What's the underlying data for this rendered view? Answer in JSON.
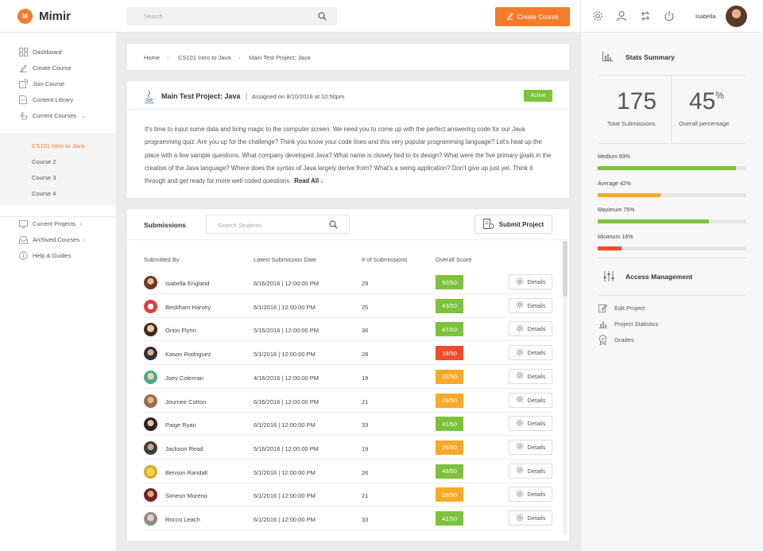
{
  "app": {
    "name": "Mimir",
    "logo_letter": "M"
  },
  "topbar": {
    "search_placeholder": "Search",
    "create_course": "Create Course",
    "username": "Isabella",
    "icons": [
      "gear-icon",
      "user-icon",
      "swap-icon",
      "power-icon"
    ]
  },
  "sidebar": {
    "items": [
      {
        "label": "Dashboard",
        "icon": "grid-icon"
      },
      {
        "label": "Create Course",
        "icon": "pencil-icon"
      },
      {
        "label": "Join Course",
        "icon": "join-icon"
      },
      {
        "label": "Content Library",
        "icon": "document-icon"
      },
      {
        "label": "Current Courses",
        "icon": "hand-icon"
      }
    ],
    "courses": [
      {
        "label": "CS101 Intro to Java",
        "active": true
      },
      {
        "label": "Course 2",
        "active": false
      },
      {
        "label": "Course 3",
        "active": false
      },
      {
        "label": "Course 4",
        "active": false
      }
    ],
    "bottom_items": [
      {
        "label": "Current Projects",
        "icon": "monitor-icon"
      },
      {
        "label": "Archived Courses",
        "icon": "inbox-icon"
      },
      {
        "label": "Help & Guides",
        "icon": "info-icon"
      }
    ]
  },
  "breadcrumb": [
    "Home",
    "CS101 Intro to Java",
    "Main Test Project: Java"
  ],
  "project": {
    "title": "Main Test Project: Java",
    "assigned": "Assigned on 8/10/2016 at 10:50pm",
    "status": "Active",
    "description": "It's time to input some data and bring magic to the computer screen. We need you to come up with the perfect answering code for our Java programming quiz. Are you up for the challenge? Think you know your code lines and this very popular programming language? Let's heat up the place with a few sample questions. What company developed Java? What name is closely tied to its design? What were the five primary goals in the creation of the Java language? Where does the syntax of Java largely derive from? What's a swing application? Don't give up just yet. Think it through and get ready for more well coded questions.",
    "read_all": "Read All ↓"
  },
  "submissions": {
    "title": "Submissions",
    "search_placeholder": "Search Students",
    "submit_button": "Submit Project",
    "headers": [
      "Submitted By",
      "Latest Submission Date",
      "# of Submissions",
      "Overall Score"
    ],
    "details_label": "Details",
    "rows": [
      {
        "name": "Isabella England",
        "date": "6/16/2016  |  12:00:00 PM",
        "count": "29",
        "score": "50/50",
        "color": "#7cc23b"
      },
      {
        "name": "Beckham Harvey",
        "date": "6/1/2016  |  12:00:00 PM",
        "count": "25",
        "score": "43/50",
        "color": "#7cc23b"
      },
      {
        "name": "Orion Flynn",
        "date": "5/16/2016  |  12:00:00 PM",
        "count": "36",
        "score": "47/50",
        "color": "#7cc23b"
      },
      {
        "name": "Kason Rodriguez",
        "date": "5/1/2016  |  12:00:00 PM",
        "count": "28",
        "score": "18/50",
        "color": "#f04a2a"
      },
      {
        "name": "Joey Coleman",
        "date": "4/16/2016  |  12:00:00 PM",
        "count": "19",
        "score": "32/50",
        "color": "#f8a928"
      },
      {
        "name": "Journee Cotton",
        "date": "6/16/2016  |  12:00:00 PM",
        "count": "21",
        "score": "29/50",
        "color": "#f8a928"
      },
      {
        "name": "Paige Ryan",
        "date": "6/1/2016  |  12:00:00 PM",
        "count": "33",
        "score": "41/50",
        "color": "#7cc23b"
      },
      {
        "name": "Jackson Read",
        "date": "5/16/2016  |  12:00:00 PM",
        "count": "19",
        "score": "26/50",
        "color": "#f8a928"
      },
      {
        "name": "Benson Randall",
        "date": "5/1/2016  |  12:00:00 PM",
        "count": "26",
        "score": "49/50",
        "color": "#7cc23b"
      },
      {
        "name": "Simeon Moreno",
        "date": "6/1/2016  |  12:00:00 PM",
        "count": "21",
        "score": "29/50",
        "color": "#f8a928"
      },
      {
        "name": "Rocco Leach",
        "date": "6/1/2016  |  12:00:00 PM",
        "count": "33",
        "score": "41/50",
        "color": "#7cc23b"
      }
    ]
  },
  "stats": {
    "title": "Stats Summary",
    "total_submissions": "175",
    "total_label": "Total Submissions",
    "overall_percentage": "45",
    "percent_sign": "%",
    "overall_label": "Overall percentage",
    "bars": [
      {
        "label": "Medium 93%",
        "value": 0.93,
        "color": "#7cc23b"
      },
      {
        "label": "Average 42%",
        "value": 0.42,
        "color": "#f8a928"
      },
      {
        "label": "Maximum 75%",
        "value": 0.75,
        "color": "#7cc23b"
      },
      {
        "label": "Minimum 16%",
        "value": 0.16,
        "color": "#f04a2a"
      }
    ]
  },
  "access": {
    "title": "Access Management",
    "links": [
      {
        "label": "Edit Project",
        "icon": "edit-icon"
      },
      {
        "label": "Project Statistics",
        "icon": "bar-chart-icon"
      },
      {
        "label": "Grades",
        "icon": "medal-icon"
      }
    ]
  },
  "colors": {
    "accent": "#f47b2a",
    "green": "#7cc23b",
    "orange": "#f8a928",
    "red": "#f04a2a"
  }
}
